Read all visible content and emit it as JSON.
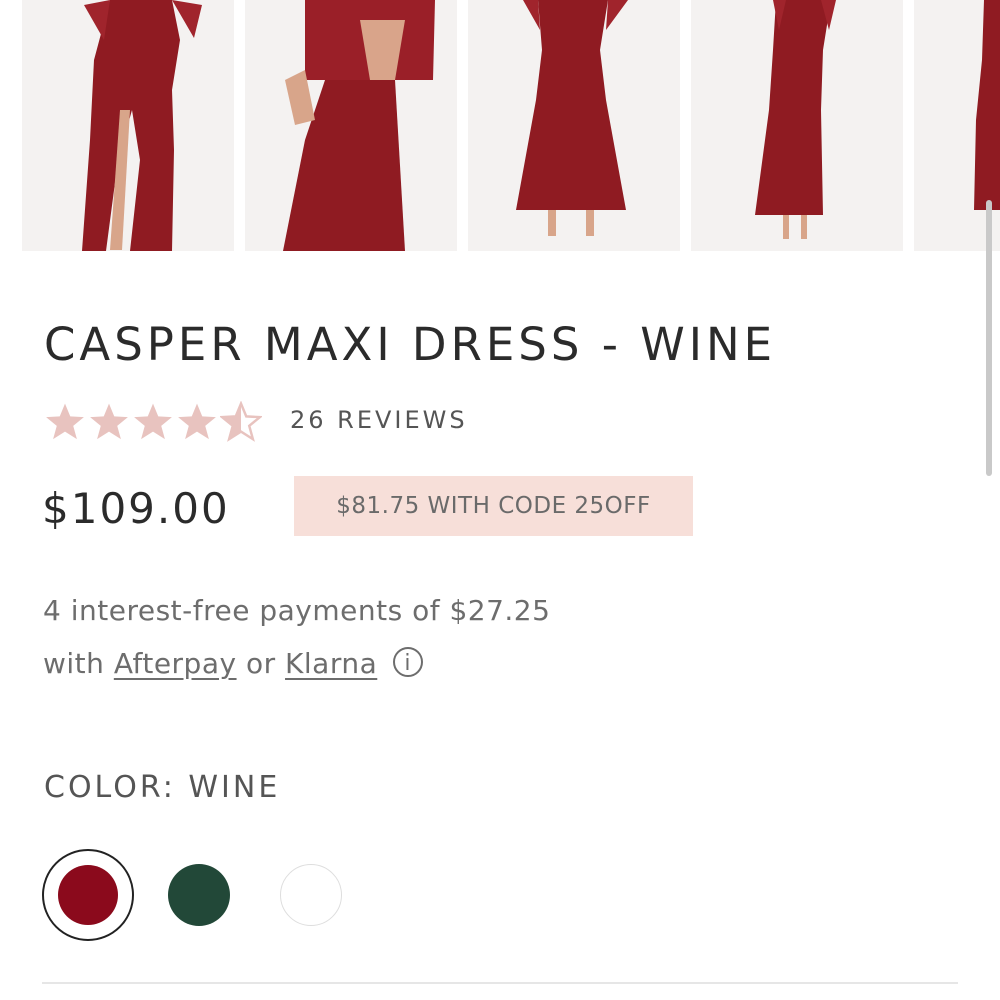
{
  "gallery": {
    "images": [
      {
        "name": "dress-front-slit"
      },
      {
        "name": "dress-back-detail"
      },
      {
        "name": "dress-front-full"
      },
      {
        "name": "dress-side-full"
      },
      {
        "name": "dress-partial"
      }
    ]
  },
  "product": {
    "title": "CASPER MAXI DRESS - WINE",
    "rating": 4.5,
    "rating_max": 5,
    "reviews_label": "26 REVIEWS",
    "price": "$109.00",
    "promo": "$81.75 WITH CODE 25OFF"
  },
  "installments": {
    "line1": "4 interest-free payments of $27.25",
    "with": "with",
    "afterpay": "Afterpay",
    "or": "or",
    "klarna": "Klarna",
    "info_icon": "i"
  },
  "color": {
    "label": "COLOR: WINE",
    "swatches": [
      {
        "name": "wine",
        "hex": "#8b0a1c",
        "selected": true
      },
      {
        "name": "green",
        "hex": "#224838",
        "selected": false
      },
      {
        "name": "white",
        "hex": "#ffffff",
        "selected": false
      }
    ]
  },
  "colors": {
    "star": "#e8c3bf",
    "promo_bg": "#f7dfd9",
    "dress": "#8f1b22"
  }
}
